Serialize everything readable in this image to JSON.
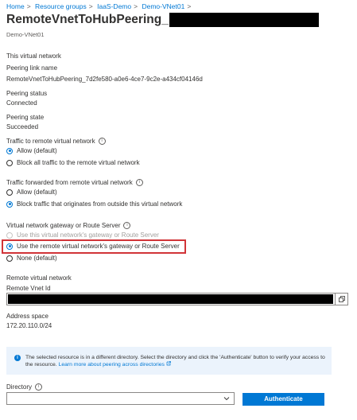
{
  "breadcrumb": {
    "items": [
      "Home",
      "Resource groups",
      "IaaS-Demo",
      "Demo-VNet01"
    ],
    "separator": ">"
  },
  "header": {
    "title": "RemoteVnetToHubPeering_",
    "subtitle": "Demo-VNet01"
  },
  "this_vnet": {
    "section_title": "This virtual network",
    "peering_link_name_label": "Peering link name",
    "peering_link_name_value": "RemoteVnetToHubPeering_7d2fe580-a0e6-4ce7-9c2e-a434cf04146d",
    "peering_status_label": "Peering status",
    "peering_status_value": "Connected",
    "peering_state_label": "Peering state",
    "peering_state_value": "Succeeded"
  },
  "traffic_remote": {
    "label": "Traffic to remote virtual network",
    "options": [
      "Allow (default)",
      "Block all traffic to the remote virtual network"
    ],
    "selected": 0
  },
  "traffic_forwarded": {
    "label": "Traffic forwarded from remote virtual network",
    "options": [
      "Allow (default)",
      "Block traffic that originates from outside this virtual network"
    ],
    "selected": 1
  },
  "gateway": {
    "label": "Virtual network gateway or Route Server",
    "options": [
      "Use this virtual network's gateway or Route Server",
      "Use the remote virtual network's gateway or Route Server",
      "None (default)"
    ],
    "selected": 1,
    "disabled": [
      0
    ],
    "highlighted": 1
  },
  "remote_vnet": {
    "section_title": "Remote virtual network",
    "remote_vnet_id_label": "Remote Vnet Id",
    "address_space_label": "Address space",
    "address_space_value": "172.20.110.0/24"
  },
  "banner": {
    "text": "The selected resource is in a different directory. Select the directory and click the 'Authenticate' button to verify your access to the resource.",
    "link_text": "Learn more about peering across directories"
  },
  "directory": {
    "label": "Directory",
    "value": ""
  },
  "authenticate_button": "Authenticate",
  "colors": {
    "accent": "#0078d4",
    "highlight": "#d13438",
    "banner_bg": "#ebf3fc"
  },
  "icons": [
    "info-icon",
    "copy-icon",
    "chevron-down-icon",
    "external-link-icon"
  ]
}
